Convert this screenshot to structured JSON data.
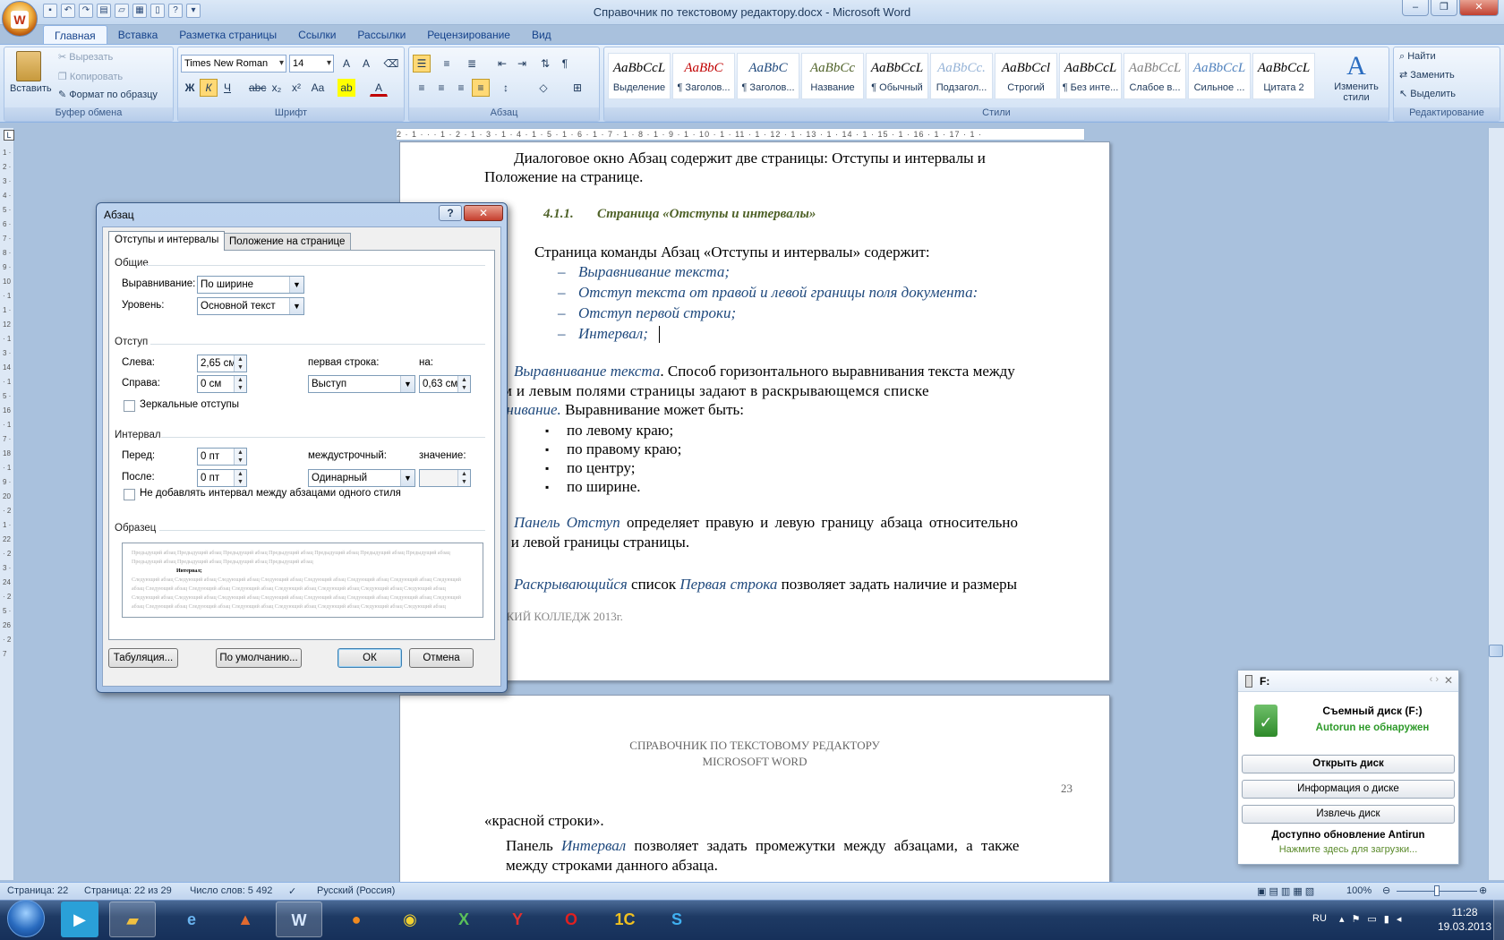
{
  "window": {
    "title": "Справочник по текстовому редактору.docx - Microsoft Word",
    "office_letter": "W"
  },
  "qat": {
    "icons": [
      "save-icon",
      "undo-icon",
      "redo-icon",
      "print-icon",
      "open-icon",
      "preview-icon",
      "new-icon",
      "help-icon",
      "customize-icon"
    ]
  },
  "tabs": [
    "Главная",
    "Вставка",
    "Разметка страницы",
    "Ссылки",
    "Рассылки",
    "Рецензирование",
    "Вид"
  ],
  "ribbon": {
    "clipboard": {
      "label": "Буфер обмена",
      "paste": "Вставить",
      "cut": "Вырезать",
      "copy": "Копировать",
      "format_painter": "Формат по образцу"
    },
    "font": {
      "label": "Шрифт",
      "name": "Times New Roman",
      "size": "14",
      "bold": "Ж",
      "italic": "К",
      "underline": "Ч",
      "strike": "abc",
      "sub": "x₂",
      "sup": "x²",
      "case": "Aa"
    },
    "paragraph": {
      "label": "Абзац"
    },
    "styles": {
      "label": "Стили",
      "items": [
        {
          "sample": "AaBbCcL",
          "name": "Выделение",
          "color": "#000000"
        },
        {
          "sample": "AaBbC",
          "name": "¶ Заголов...",
          "color": "#c00000"
        },
        {
          "sample": "AaBbC",
          "name": "¶ Заголов...",
          "color": "#1f497d"
        },
        {
          "sample": "AaBbCc",
          "name": "Название",
          "color": "#4f6228"
        },
        {
          "sample": "AaBbCcL",
          "name": "¶ Обычный",
          "color": "#000000"
        },
        {
          "sample": "AaBbCc.",
          "name": "Подзагол...",
          "color": "#95b3d7"
        },
        {
          "sample": "AaBbCcl",
          "name": "Строгий",
          "color": "#000000"
        },
        {
          "sample": "AaBbCcL",
          "name": "¶ Без инте...",
          "color": "#000000"
        },
        {
          "sample": "AaBbCcL",
          "name": "Слабое в...",
          "color": "#808080"
        },
        {
          "sample": "AaBbCcL",
          "name": "Сильное ...",
          "color": "#4f81bd"
        },
        {
          "sample": "AaBbCcL",
          "name": "Цитата 2",
          "color": "#000000"
        }
      ],
      "change": "Изменить стили"
    },
    "editing": {
      "label": "Редактирование",
      "find": "Найти",
      "replace": "Заменить",
      "select": "Выделить"
    }
  },
  "ruler": {
    "text": "2 · 1 · · · 1 · 2 · 1 · 3 · 1 · 4 · 1 · 5 · 1 · 6 · 1 · 7 · 1 · 8 · 1 · 9 · 1 · 10 · 1 · 11 · 1 · 12 · 1 · 13 · 1 · 14 · 1 · 15 · 1 · 16 · 1 · 17 · 1 ·"
  },
  "vruler": {
    "text": "1 · 2 · 3 · 4 · 5 · 6 · 7 · 8 · 9 · 10 · 11 · 12 · 13 · 14 · 15 · 16 · 17 · 18 · 19 · 20 · 21 · 22 · 23 · 24 · 25 · 26 · 27"
  },
  "doc": {
    "p1a": "Диалоговое окно Абзац содержит две страницы: Отступы и интервалы и",
    "p1b": "Положение на странице.",
    "heading_num": "4.1.1.",
    "heading": "Страница «Отступы и интервалы»",
    "p2": "Страница команды Абзац «Отступы и интервалы» содержит:",
    "dash": "–",
    "list": [
      "Выравнивание текста;",
      "Отступ текста от правой и левой границы поля документа:",
      "Отступ первой строки;",
      "Интервал;"
    ],
    "p3_it": "Выравнивание текста",
    "p3a": ". Способ горизонтального выравнивания текста между",
    "p3b": "вым и левым полями страницы задают в раскрывающемся списке",
    "p3c_it": "равнивание.",
    "p3c": " Выравнивание может быть:",
    "bullet": "▪",
    "bullets": [
      "по левому краю;",
      "по правому краю;",
      "по центру;",
      "по ширине."
    ],
    "p4_it": "Панель Отступ",
    "p4a": " определяет правую и левую границу абзаца относительно",
    "p4b": "вой и левой границы страницы.",
    "p5_it1": "Раскрывающийся",
    "p5a": " список ",
    "p5_it2": "Первая строка",
    "p5b": " позволяет задать наличие и размеры",
    "footer": "ЛЬСКИЙ КОЛЛЕДЖ 2013г.",
    "header2a": "СПРАВОЧНИК ПО ТЕКСТОВОМУ РЕДАКТОРУ",
    "header2b": "MICROSOFT WORD",
    "pagenum": "23",
    "p6": "«красной строки».",
    "p7a": "Панель ",
    "p7_it": "Интервал",
    "p7b": " позволяет задать промежутки между абзацами, а также",
    "p7c": "между строками данного абзаца."
  },
  "dialog": {
    "title": "Абзац",
    "help": "?",
    "close": "✕",
    "tab1": "Отступы и интервалы",
    "tab2": "Положение на странице",
    "general": "Общие",
    "align_label": "Выравнивание:",
    "align_value": "По ширине",
    "level_label": "Уровень:",
    "level_value": "Основной текст",
    "indent": "Отступ",
    "left_label": "Слева:",
    "left_value": "2,65 см",
    "right_label": "Справа:",
    "right_value": "0 см",
    "first_label": "первая строка:",
    "first_value": "Выступ",
    "by_label": "на:",
    "by_value": "0,63 см",
    "mirror": "Зеркальные отступы",
    "interval": "Интервал",
    "before_label": "Перед:",
    "before_value": "0 пт",
    "after_label": "После:",
    "after_value": "0 пт",
    "linesp_label": "междустрочный:",
    "linesp_value": "Одинарный",
    "at_label": "значение:",
    "at_value": "",
    "noadd": "Не добавлять интервал между абзацами одного стиля",
    "sample": "Образец",
    "preview_prev": "Предыдущий абзац Предыдущий абзац Предыдущий абзац Предыдущий абзац Предыдущий абзац Предыдущий абзац Предыдущий абзац Предыдущий абзац Предыдущий абзац Предыдущий абзац Предыдущий абзац",
    "preview_cur": "Интервал;",
    "preview_next": "Следующий абзац Следующий абзац Следующий абзац Следующий абзац Следующий абзац Следующий абзац Следующий абзац Следующий абзац Следующий абзац Следующий абзац Следующий абзац Следующий абзац Следующий абзац Следующий абзац Следующий абзац Следующий абзац Следующий абзац Следующий абзац Следующий абзац Следующий абзац Следующий абзац Следующий абзац Следующий абзац Следующий абзац Следующий абзац Следующий абзац Следующий абзац Следующий абзац Следующий абзац Следующий абзац",
    "tabs_btn": "Табуляция...",
    "default_btn": "По умолчанию...",
    "ok": "ОК",
    "cancel": "Отмена"
  },
  "usb": {
    "drive": "F:",
    "title": "Съемный диск  (F:)",
    "status": "Autorun не обнаружен",
    "open": "Открыть диск",
    "info": "Информация о диске",
    "eject": "Извлечь диск",
    "update": "Доступно обновление Antirun",
    "update_link": "Нажмите здесь для загрузки..."
  },
  "status": {
    "page": "Страница: 22",
    "pages": "Страница: 22 из 29",
    "words": "Число слов: 5 492",
    "lang": "Русский (Россия)",
    "zoom": "100%"
  },
  "taskbar": {
    "lang": "RU",
    "time": "11:28",
    "date": "19.03.2013"
  }
}
